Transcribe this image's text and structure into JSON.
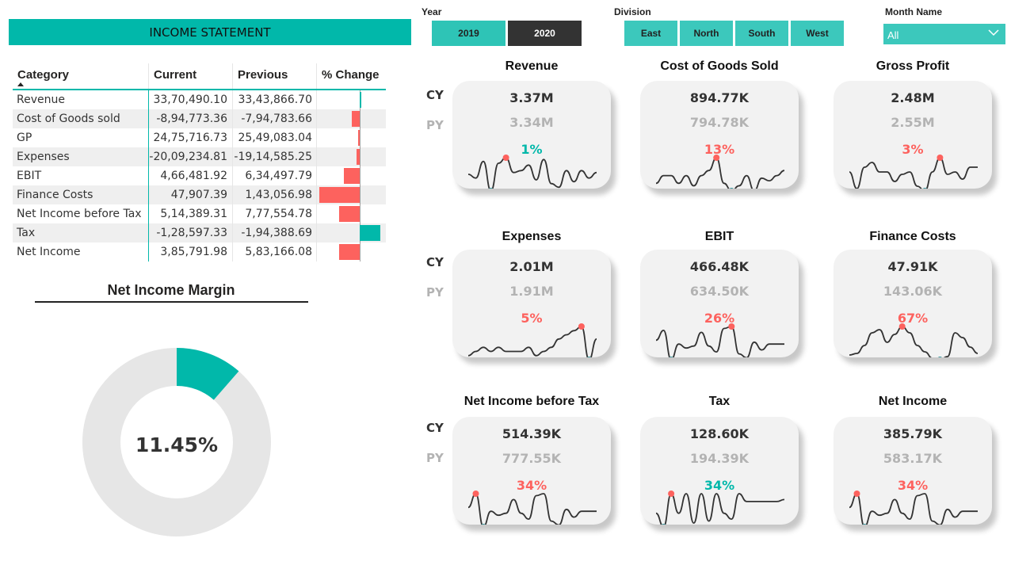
{
  "statement": {
    "title": "INCOME STATEMENT",
    "headers": {
      "category": "Category",
      "current": "Current",
      "previous": "Previous",
      "change": "% Change"
    },
    "rows": [
      {
        "category": "Revenue",
        "current": "33,70,490.10",
        "previous": "33,43,866.70",
        "change_pct": 1
      },
      {
        "category": "Cost of Goods sold",
        "current": "-8,94,773.36",
        "previous": "-7,94,783.66",
        "change_pct": -13
      },
      {
        "category": "GP",
        "current": "24,75,716.73",
        "previous": "25,49,083.04",
        "change_pct": -3
      },
      {
        "category": "Expenses",
        "current": "-20,09,234.81",
        "previous": "-19,14,585.25",
        "change_pct": -5
      },
      {
        "category": "EBIT",
        "current": "4,66,481.92",
        "previous": "6,34,497.79",
        "change_pct": -26
      },
      {
        "category": "Finance Costs",
        "current": "47,907.39",
        "previous": "1,43,056.98",
        "change_pct": -67
      },
      {
        "category": "Net Income before Tax",
        "current": "5,14,389.31",
        "previous": "7,77,554.78",
        "change_pct": -34
      },
      {
        "category": "Tax",
        "current": "-1,28,597.33",
        "previous": "-1,94,388.69",
        "change_pct": 34
      },
      {
        "category": "Net Income",
        "current": "3,85,791.98",
        "previous": "5,83,166.08",
        "change_pct": -34
      }
    ]
  },
  "net_income_margin": {
    "title": "Net Income Margin",
    "value_label": "11.45%",
    "value": 11.45
  },
  "slicers": {
    "year": {
      "label": "Year",
      "options": [
        "2019",
        "2020"
      ],
      "selected": "2020"
    },
    "division": {
      "label": "Division",
      "options": [
        "East",
        "North",
        "South",
        "West"
      ]
    },
    "month": {
      "label": "Month Name",
      "value": "All"
    }
  },
  "row_labels": {
    "cy": "CY",
    "py": "PY"
  },
  "kpis": [
    {
      "title": "Revenue",
      "cy": "3.37M",
      "py": "3.34M",
      "change": "1%",
      "trend": "good",
      "spark": [
        26,
        22,
        40,
        8,
        38,
        44,
        28,
        30,
        36,
        20,
        42,
        16,
        12,
        30,
        18,
        30,
        22,
        28
      ],
      "low": 2,
      "high": 1
    },
    {
      "title": "Cost of Goods Sold",
      "cy": "894.77K",
      "py": "794.78K",
      "change": "13%",
      "trend": "bad",
      "spark": [
        20,
        26,
        26,
        20,
        26,
        18,
        26,
        30,
        40,
        20,
        14,
        18,
        26,
        14,
        24,
        22,
        26,
        30
      ],
      "low": 8,
      "high": -1
    },
    {
      "title": "Gross Profit",
      "cy": "2.48M",
      "py": "2.55M",
      "change": "3%",
      "trend": "bad",
      "spark": [
        26,
        12,
        30,
        34,
        26,
        26,
        18,
        24,
        26,
        14,
        10,
        26,
        38,
        24,
        26,
        20,
        30,
        30
      ],
      "low": 2,
      "high": 12
    },
    {
      "title": "Expenses",
      "cy": "2.01M",
      "py": "1.91M",
      "change": "5%",
      "trend": "bad",
      "spark": [
        10,
        12,
        14,
        12,
        14,
        12,
        12,
        12,
        14,
        10,
        12,
        14,
        18,
        20,
        22,
        24,
        8,
        18
      ],
      "low": 15,
      "high": -1
    },
    {
      "title": "EBIT",
      "cy": "466.48K",
      "py": "634.50K",
      "change": "26%",
      "trend": "bad",
      "spark": [
        26,
        36,
        6,
        22,
        18,
        20,
        34,
        20,
        14,
        38,
        40,
        12,
        8,
        24,
        16,
        22,
        22,
        22
      ],
      "low": 2,
      "high": 1
    },
    {
      "title": "Finance Costs",
      "cy": "47.91K",
      "py": "143.06K",
      "change": "67%",
      "trend": "bad",
      "spark": [
        8,
        10,
        20,
        36,
        40,
        24,
        34,
        44,
        36,
        20,
        12,
        4,
        2,
        6,
        36,
        30,
        18,
        10
      ],
      "low": 13,
      "high": 7
    },
    {
      "title": "Net Income before Tax",
      "cy": "514.39K",
      "py": "777.55K",
      "change": "34%",
      "trend": "bad",
      "spark": [
        26,
        40,
        6,
        22,
        18,
        20,
        34,
        20,
        14,
        38,
        40,
        12,
        8,
        24,
        16,
        22,
        22,
        22
      ],
      "low": 2,
      "high": 1
    },
    {
      "title": "Tax",
      "cy": "128.60K",
      "py": "194.39K",
      "change": "34%",
      "trend": "good",
      "spark": [
        20,
        6,
        40,
        20,
        40,
        10,
        40,
        12,
        40,
        20,
        14,
        40,
        32,
        32,
        32,
        32,
        32,
        34
      ],
      "low": 1,
      "high": 2
    },
    {
      "title": "Net Income",
      "cy": "385.79K",
      "py": "583.17K",
      "change": "34%",
      "trend": "bad",
      "spark": [
        26,
        40,
        6,
        22,
        18,
        20,
        34,
        20,
        14,
        38,
        40,
        12,
        8,
        24,
        16,
        22,
        22,
        22
      ],
      "low": 2,
      "high": 1
    }
  ],
  "colors": {
    "teal": "#01b8aa",
    "red": "#fd625e",
    "good": "#01b8aa",
    "bad": "#fd625e",
    "dot_high": "#2b8f96"
  }
}
